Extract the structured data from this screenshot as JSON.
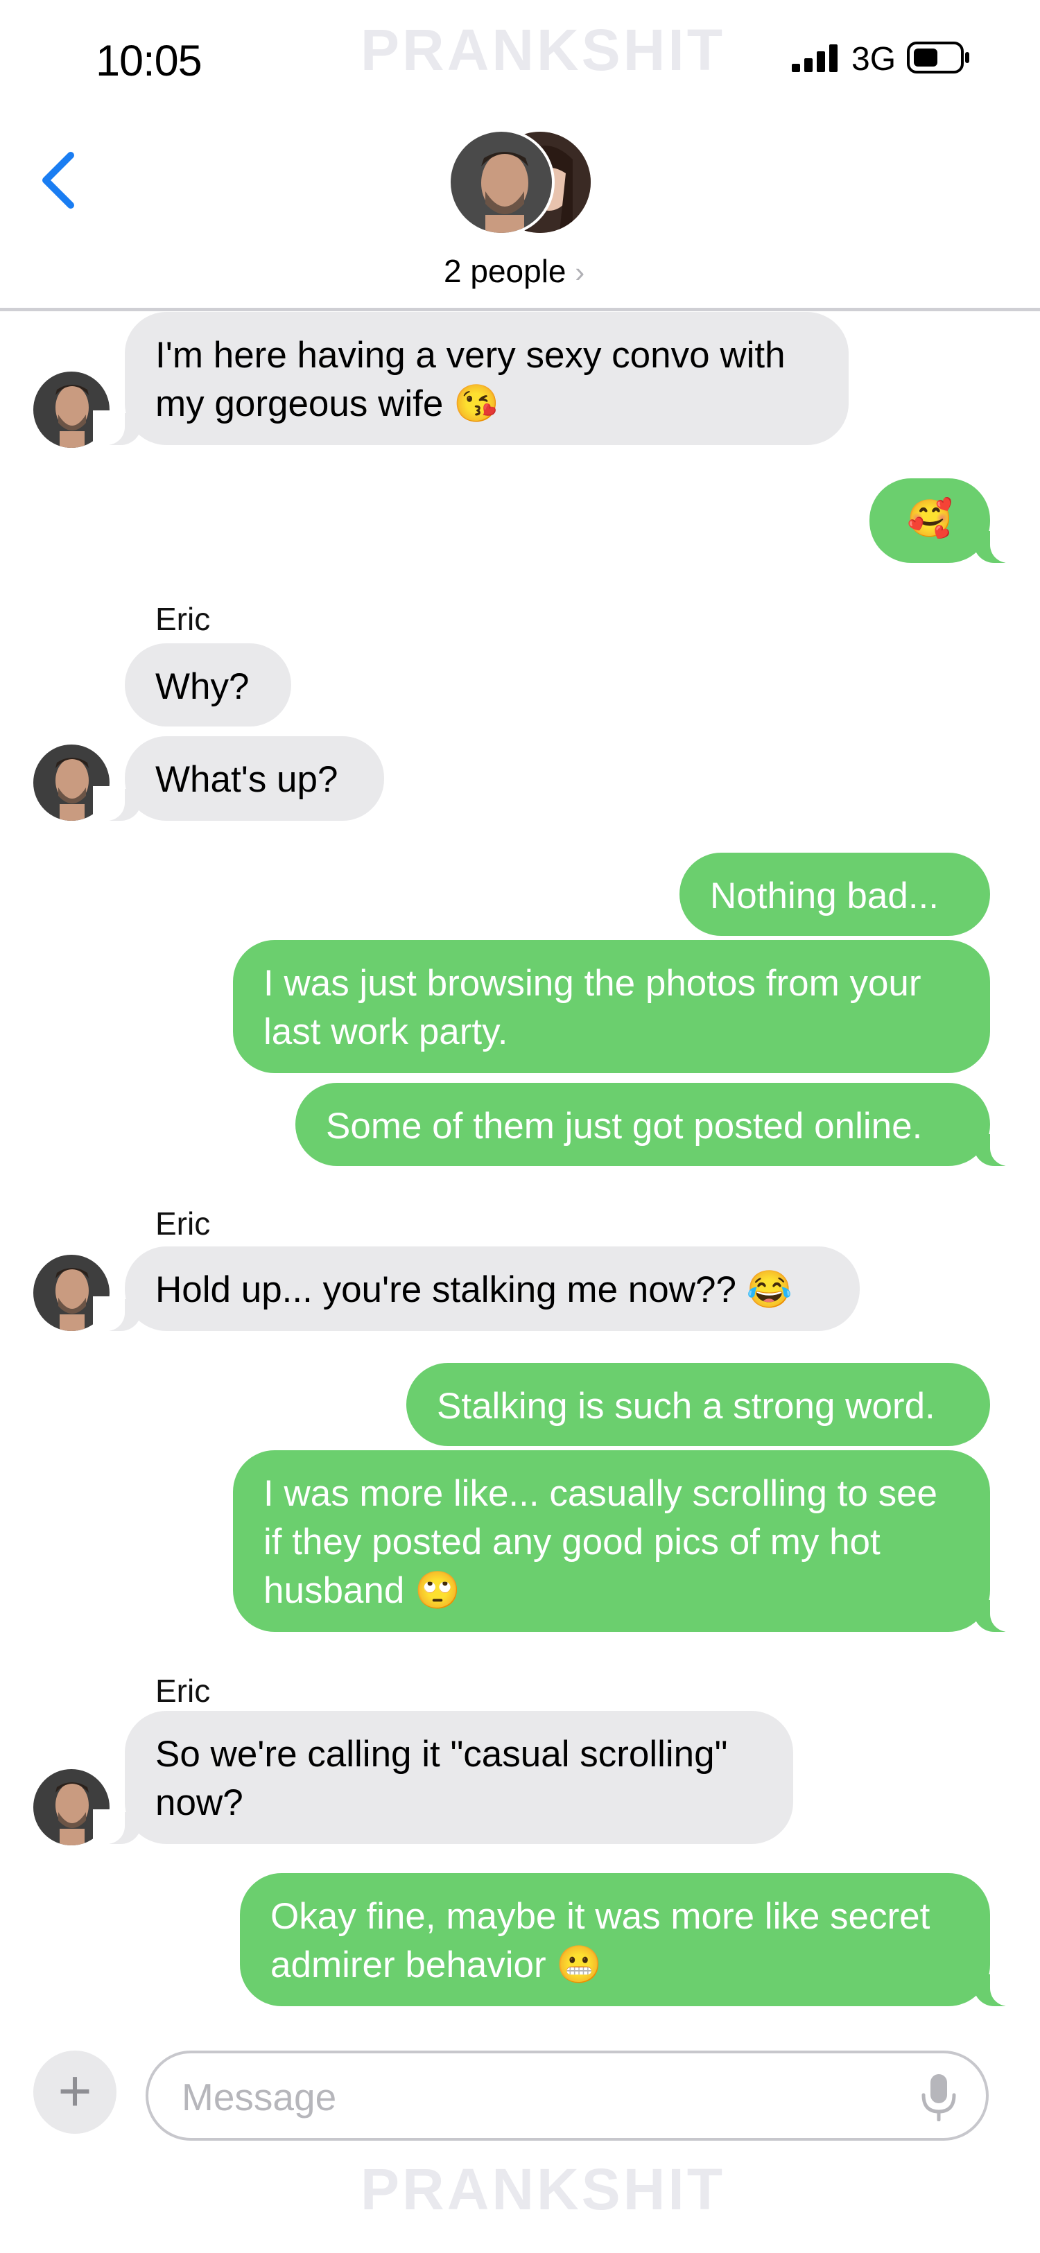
{
  "status_bar": {
    "time": "10:05",
    "network": "3G",
    "watermark": "PRANKSHIT"
  },
  "header": {
    "group_title": "2 people",
    "chevron": "›",
    "back_icon": "chevron-left-icon",
    "accent": "#1a7df2"
  },
  "colors": {
    "incoming_bubble": "#e9e9eb",
    "outgoing_bubble": "#6bcf6e"
  },
  "messages": [
    {
      "from": "them",
      "text": "I'm here having a very sexy convo with my gorgeous wife",
      "emoji": "😘"
    },
    {
      "from": "me",
      "text": "",
      "emoji": "🥰"
    },
    {
      "from": "them",
      "sender": "Eric",
      "text": "Why?"
    },
    {
      "from": "them",
      "text": "What's up?"
    },
    {
      "from": "me",
      "text": "Nothing bad..."
    },
    {
      "from": "me",
      "text": "I was just browsing the photos from your last work party."
    },
    {
      "from": "me",
      "text": "Some of them just got posted online."
    },
    {
      "from": "them",
      "sender": "Eric",
      "text": "Hold up... you're stalking me now??",
      "emoji": "😂"
    },
    {
      "from": "me",
      "text": "Stalking is such a strong word."
    },
    {
      "from": "me",
      "text": "I was more like... casually scrolling to see if they posted any good pics of my hot husband",
      "emoji": "🙄"
    },
    {
      "from": "them",
      "sender": "Eric",
      "text": "So we're calling it \"casual scrolling\" now?"
    },
    {
      "from": "me",
      "text": "Okay fine, maybe it was more like secret admirer behavior",
      "emoji": "😬"
    }
  ],
  "composer": {
    "placeholder": "Message",
    "plus_label": "+",
    "mic_icon": "microphone-icon"
  }
}
